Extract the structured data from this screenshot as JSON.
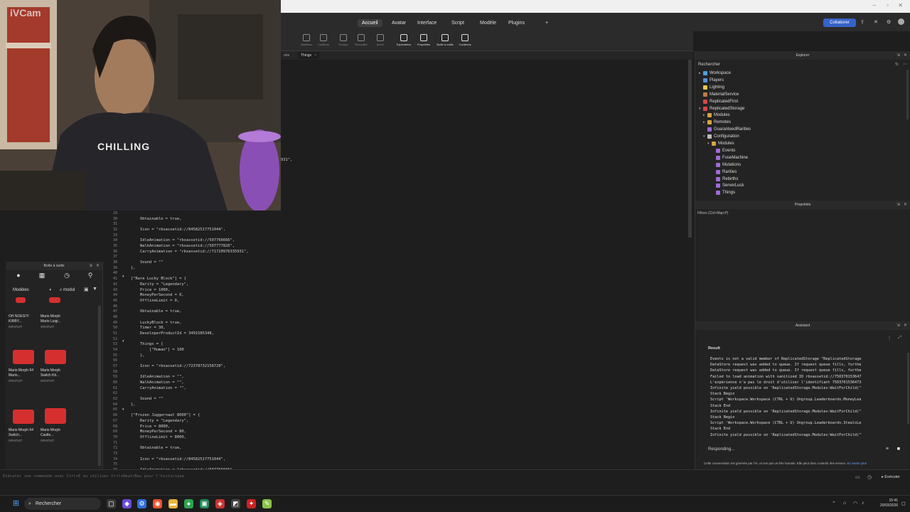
{
  "webcam": {
    "overlay_text": "iVCam",
    "hoodie_text": "CHILLING"
  },
  "ribbon": {
    "tabs": [
      "Accueil",
      "Avatar",
      "Interface",
      "Script",
      "Modèle",
      "Plugins"
    ],
    "add_tab": "+",
    "collaborate_label": "Collaborer",
    "tools": [
      {
        "label": "Matériau",
        "lit": false
      },
      {
        "label": "Couleurs",
        "lit": false
      },
      {
        "label": "Groupe",
        "lit": false
      },
      {
        "label": "Verrouiller",
        "lit": false
      },
      {
        "label": "Ancre",
        "lit": false
      },
      {
        "label": "Explorateur",
        "lit": true
      },
      {
        "label": "Propriétés",
        "lit": true
      },
      {
        "label": "Boîte à outils",
        "lit": true
      },
      {
        "label": "Contenus",
        "lit": true
      }
    ],
    "partial_left": "porter"
  },
  "doc_tabs": {
    "partial": "ons",
    "active": "Things",
    "close": "×"
  },
  "editor": {
    "stray_text": "931\",",
    "line_numbers": [
      "29",
      "30",
      "31",
      "32",
      "33",
      "34",
      "35",
      "36",
      "37",
      "38",
      "39",
      "40",
      "41",
      "42",
      "43",
      "44",
      "45",
      "46",
      "47",
      "48",
      "49",
      "50",
      "51",
      "52",
      "53",
      "54",
      "55",
      "56",
      "57",
      "58",
      "59",
      "60",
      "61",
      "62",
      "63",
      "64",
      "65",
      "66",
      "67",
      "68",
      "69",
      "70",
      "71",
      "72",
      "73",
      "74",
      "75",
      "76",
      "77"
    ],
    "lines": [
      "",
      "    Obtainable = true,",
      "",
      "    Icon = \"rbxassetid://84582517751044\",",
      "",
      "    IdleAnimation = \"rbxassetid://507766666\",",
      "    WalkAnimation = \"rbxassetid://507777826\",",
      "    CarryAnimation = \"rbxassetid://71720976335931\",",
      "",
      "    Sound = \"\"",
      "},",
      "",
      "[\"Rare Lucky Block\"] = {",
      "    Rarity = \"Legendary\",",
      "    Price = 1000,",
      "    MoneyPerSecond = 0,",
      "    OfflineLimit = 0,",
      "",
      "    Obtainable = true,",
      "",
      "    LuckyBlock = true,",
      "    Timer = 30,",
      "    DeveloperProductId = 3491585348,",
      "",
      "    Things = {",
      "        [\"Human\"] = 100",
      "    },",
      "",
      "    Icon = \"rbxassetid://72378732158720\",",
      "",
      "    IdleAnimation = \"\",",
      "    WalkAnimation = \"\",",
      "    CarryAnimation = \"\",",
      "",
      "    Sound = \"\"",
      "},",
      "",
      "[\"Frozen Juggernaut 8000\"] = {",
      "    Rarity = \"Legendary\",",
      "    Price = 8000,",
      "    MoneyPerSecond = 80,",
      "    OfflineLimit = 8000,",
      "",
      "    Obtainable = true,",
      "",
      "    Icon = \"rbxassetid://84582517751044\",",
      "",
      "    IdleAnimation = \"rbxassetid://507766666\",",
      "    WalkAnimation = \"rbxassetid://507777826\","
    ]
  },
  "toolbox": {
    "title": "Boîte à outils",
    "category": "Modèles",
    "search_value": "modul",
    "assets": [
      {
        "name": "OH NOES!!!! KIRBY...",
        "price": "GRATUIT"
      },
      {
        "name": "Mario Morph Mario Luigi...",
        "price": "GRATUIT"
      },
      {
        "name": "Mario Morph 64 Mario...",
        "price": "GRATUIT"
      },
      {
        "name": "Mario Morph Switch Kit...",
        "price": "GRATUIT"
      },
      {
        "name": "Mario Morph 64 Switch...",
        "price": "GRATUIT"
      },
      {
        "name": "Mario Morph Castle...",
        "price": "GRATUIT"
      }
    ]
  },
  "explorer": {
    "title": "Explorer",
    "search_placeholder": "Rechercher",
    "items": [
      {
        "label": "Workspace",
        "color": "#4aa3df"
      },
      {
        "label": "Players",
        "color": "#5a8fd8"
      },
      {
        "label": "Lighting",
        "color": "#e6c84a"
      },
      {
        "label": "MaterialService",
        "color": "#c07a4a"
      },
      {
        "label": "ReplicatedFirst",
        "color": "#d24a4a"
      },
      {
        "label": "ReplicatedStorage",
        "color": "#d24a4a"
      },
      {
        "label": "Modules",
        "color": "#d9a441"
      },
      {
        "label": "Remotes",
        "color": "#d9a441"
      },
      {
        "label": "GuaranteedRarities",
        "color": "#a06ad8"
      },
      {
        "label": "Configuration",
        "color": "#bbbbbb"
      },
      {
        "label": "Modules",
        "color": "#d9a441"
      },
      {
        "label": "Events",
        "color": "#a06ad8"
      },
      {
        "label": "FuseMachine",
        "color": "#a06ad8"
      },
      {
        "label": "Mutations",
        "color": "#a06ad8"
      },
      {
        "label": "Rarities",
        "color": "#a06ad8"
      },
      {
        "label": "Rebirths",
        "color": "#a06ad8"
      },
      {
        "label": "ServerLuck",
        "color": "#a06ad8"
      },
      {
        "label": "Things",
        "color": "#a06ad8"
      }
    ]
  },
  "properties": {
    "title": "Propriétés",
    "filter_placeholder": "Filtres (Ctrl+Maj+P)"
  },
  "assistant": {
    "title": "Assistant",
    "result_label": "Result",
    "output": [
      "Events is not a valid member of ReplicatedStorage \"ReplicatedStorage",
      "DataStore request was added to queue. If request queue fills, furthe",
      "DataStore request was added to queue. If request queue fills, furthe",
      "Failed to load animation with sanitized ID rbxassetid://750370153647",
      "L'expérience n'a pas le droit d'utiliser l'identifiant 7503701536473",
      "Infinite yield possible on 'ReplicatedStorage.Modules:WaitForChild(\"",
      "Stack Begin",
      "Script 'Workspace.Workspace (CTRL + U) Ungroup.Leaderboards.MoneyLea",
      "Stack End",
      "Infinite yield possible on 'ReplicatedStorage.Modules:WaitForChild(\"",
      "Stack Begin",
      "Script 'Workspace.Workspace (CTRL + U) Ungroup.Leaderboards.StealsLe",
      "Stack End",
      "Infinite yield possible on 'ReplicatedStorage.Modules:WaitForChild(\""
    ],
    "status": "Responding...",
    "disclaimer": "Cette conversation est générée par l'IA, et non par un être humain. Elle peut donc contenir des erreurs.",
    "learn_more": "En savoir plus"
  },
  "command_bar": {
    "placeholder": "Exécuter une commande avec Ctrl+E ou utiliser Ctrl+Haut/Bas pour l'historique",
    "run_label": "Exécuter"
  },
  "taskbar": {
    "search_label": "Rechercher",
    "time": "15:41",
    "date": "20/03/2026"
  }
}
